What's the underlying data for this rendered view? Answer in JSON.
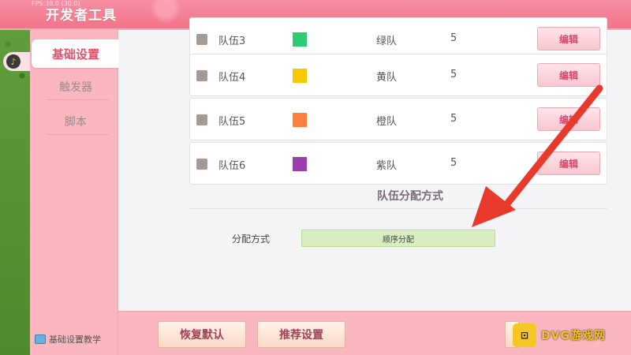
{
  "header": {
    "title": "开发者工具",
    "fps": "FPS:38.0 (30.0)"
  },
  "sidebar": {
    "items": [
      {
        "label": "基础设置",
        "active": true
      },
      {
        "label": "触发器",
        "active": false
      },
      {
        "label": "脚本",
        "active": false
      }
    ],
    "tutorial_label": "基础设置教学"
  },
  "teams": [
    {
      "name": "队伍3",
      "color": "#2ecc71",
      "color_name": "绿队",
      "count": "5",
      "edit_label": "编辑"
    },
    {
      "name": "队伍4",
      "color": "#f5c800",
      "color_name": "黄队",
      "count": "5",
      "edit_label": "编辑"
    },
    {
      "name": "队伍5",
      "color": "#ff7f3f",
      "color_name": "橙队",
      "count": "5",
      "edit_label": "编辑"
    },
    {
      "name": "队伍6",
      "color": "#9b3fb0",
      "color_name": "紫队",
      "count": "5",
      "edit_label": "编辑"
    }
  ],
  "distribution": {
    "section_title": "队伍分配方式",
    "label": "分配方式",
    "value": "顺序分配"
  },
  "bottom": {
    "restore_default": "恢复默认",
    "recommended": "推荐设置"
  },
  "watermark": {
    "text": "DVG游戏网",
    "icon": "gamepad-icon"
  },
  "colors": {
    "accent": "#f27489",
    "arrow": "#e8392a"
  }
}
